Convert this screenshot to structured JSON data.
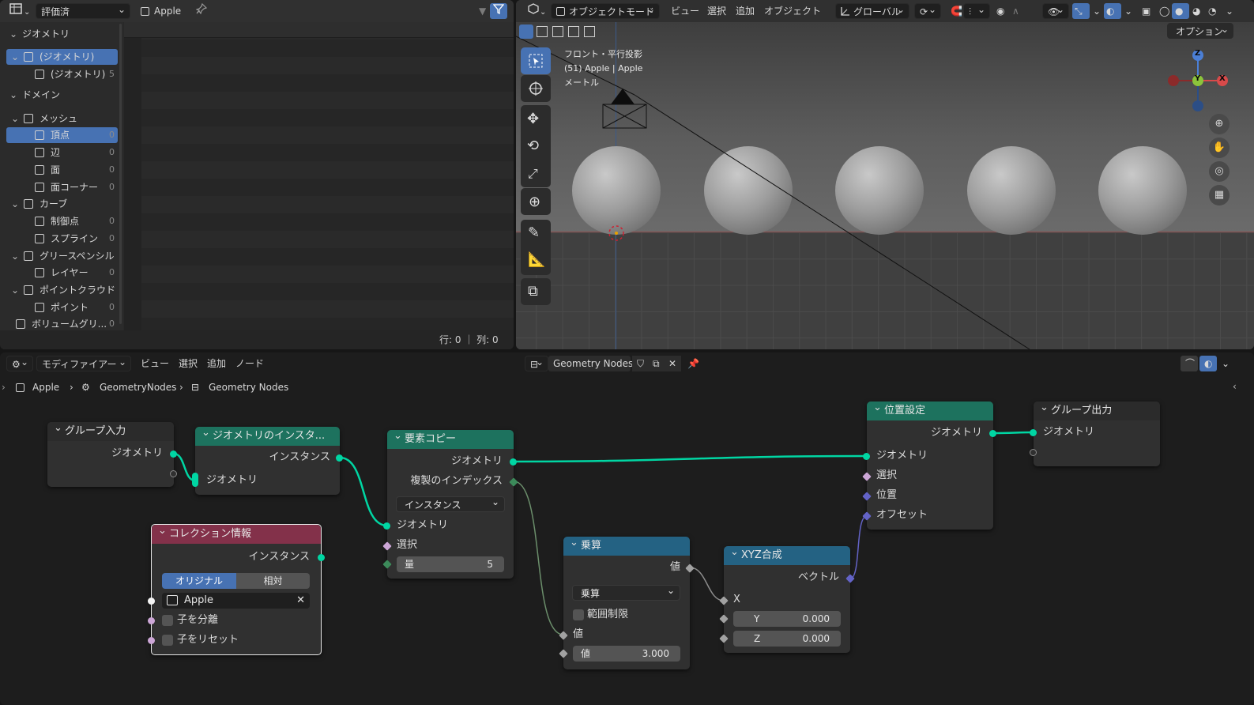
{
  "spreadsheet": {
    "eval_dropdown": "評価済",
    "object_name": "Apple",
    "tree": [
      {
        "label": "ジオメトリ",
        "level": 0,
        "count": ""
      },
      {
        "label": "(ジオメトリ)",
        "level": 1,
        "count": ""
      },
      {
        "label": "(ジオメトリ)",
        "level": 2,
        "count": "5"
      },
      {
        "label": "ドメイン",
        "level": 0,
        "count": ""
      },
      {
        "label": "メッシュ",
        "level": 1,
        "count": ""
      },
      {
        "label": "頂点",
        "level": 2,
        "count": "0"
      },
      {
        "label": "辺",
        "level": 2,
        "count": "0"
      },
      {
        "label": "面",
        "level": 2,
        "count": "0"
      },
      {
        "label": "面コーナー",
        "level": 2,
        "count": "0"
      },
      {
        "label": "カーブ",
        "level": 1,
        "count": ""
      },
      {
        "label": "制御点",
        "level": 2,
        "count": "0"
      },
      {
        "label": "スプライン",
        "level": 2,
        "count": "0"
      },
      {
        "label": "グリースペンシル",
        "level": 1,
        "count": ""
      },
      {
        "label": "レイヤー",
        "level": 2,
        "count": "0"
      },
      {
        "label": "ポイントクラウド",
        "level": 1,
        "count": ""
      },
      {
        "label": "ポイント",
        "level": 2,
        "count": "0"
      },
      {
        "label": "ボリュームグリ...",
        "level": 1,
        "count": "0"
      }
    ],
    "status": "行: 0 ｜ 列: 0"
  },
  "viewport": {
    "mode": "オブジェクトモード",
    "menu": [
      "ビュー",
      "選択",
      "追加",
      "オブジェクト"
    ],
    "transform_orientation": "グローバル",
    "options": "オプション",
    "overlay_lines": [
      "フロント・平行投影",
      "(51) Apple | Apple",
      "メートル"
    ],
    "gizmo": {
      "z": "Z",
      "y": "Y",
      "x": "X"
    }
  },
  "node_editor": {
    "editor_type": "モディファイアー",
    "menu": [
      "ビュー",
      "選択",
      "追加",
      "ノード"
    ],
    "tree_name": "Geometry Nodes",
    "breadcrumb": [
      "Apple",
      "GeometryNodes",
      "Geometry Nodes"
    ],
    "nodes": {
      "group_input": {
        "title": "グループ入力",
        "out_geo": "ジオメトリ"
      },
      "realize": {
        "title": "ジオメトリのインスタ...",
        "out": "インスタンス",
        "in": "ジオメトリ"
      },
      "collection_info": {
        "title": "コレクション情報",
        "out": "インスタンス",
        "tab_original": "オリジナル",
        "tab_relative": "相対",
        "collection": "Apple",
        "separate": "子を分離",
        "reset": "子をリセット"
      },
      "duplicate": {
        "title": "要素コピー",
        "out_geo": "ジオメトリ",
        "out_index": "複製のインデックス",
        "domain": "インスタンス",
        "in_geo": "ジオメトリ",
        "in_sel": "選択",
        "amount_label": "量",
        "amount_value": "5"
      },
      "multiply": {
        "title": "乗算",
        "out": "値",
        "op": "乗算",
        "clamp": "範囲制限",
        "in_val": "値",
        "field_label": "値",
        "field_value": "3.000"
      },
      "combine_xyz": {
        "title": "XYZ合成",
        "out": "ベクトル",
        "x": "X",
        "y_label": "Y",
        "y_value": "0.000",
        "z_label": "Z",
        "z_value": "0.000"
      },
      "set_position": {
        "title": "位置設定",
        "out": "ジオメトリ",
        "in_geo": "ジオメトリ",
        "in_sel": "選択",
        "in_pos": "位置",
        "in_offset": "オフセット"
      },
      "group_output": {
        "title": "グループ出力",
        "in": "ジオメトリ"
      }
    }
  },
  "colors": {
    "geometry_socket": "#00d6a3",
    "node_geo_header": "#1d725e",
    "node_math_header": "#246283",
    "node_input_header": "#83314a",
    "selection_blue": "#4772b3"
  }
}
